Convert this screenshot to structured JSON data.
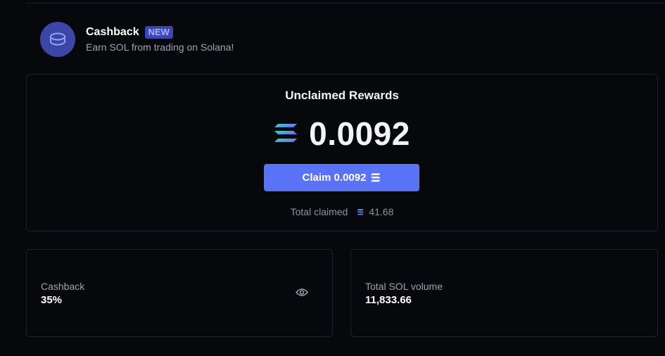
{
  "header": {
    "title": "Cashback",
    "badge": "NEW",
    "subtitle": "Earn SOL from trading on Solana!",
    "icon": "coin-stack-icon"
  },
  "rewards": {
    "title": "Unclaimed Rewards",
    "amount": "0.0092",
    "claim_label": "Claim 0.0092",
    "total_claimed_label": "Total claimed",
    "total_claimed_value": "41.68"
  },
  "stats": {
    "cashback_label": "Cashback",
    "cashback_value": "35%",
    "volume_label": "Total SOL volume",
    "volume_value": "11,833.66"
  },
  "colors": {
    "accent": "#5a72f5",
    "badge_bg": "#3a45b8",
    "background": "#07080c",
    "sol_gradient": [
      "#14f1b0",
      "#9945ff"
    ]
  }
}
